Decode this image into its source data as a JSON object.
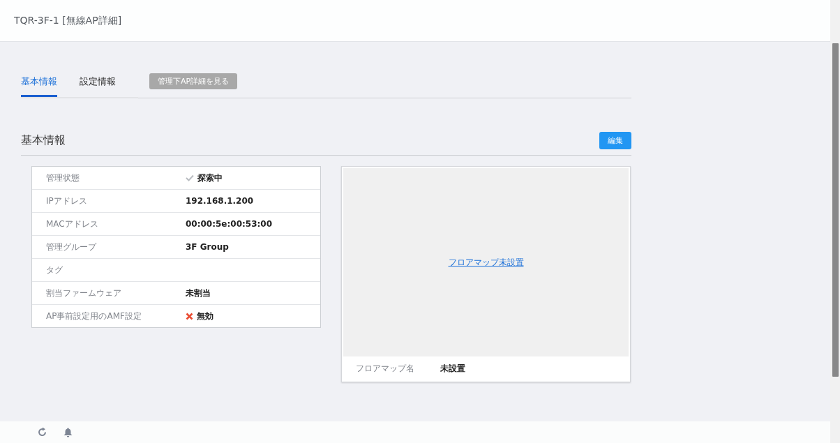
{
  "window": {
    "title": "TQR-3F-1 [無線AP詳細]"
  },
  "tabs": [
    {
      "label": "基本情報",
      "selected": true
    },
    {
      "label": "設定情報",
      "selected": false
    }
  ],
  "view_button": {
    "label": "管理下AP詳細を見る",
    "disabled": true
  },
  "section": {
    "title": "基本情報",
    "edit_button": "編集"
  },
  "details": [
    {
      "kind": "check",
      "label": "管理状態",
      "value": "探索中"
    },
    {
      "kind": "plain",
      "label": "IPアドレス",
      "value": "192.168.1.200"
    },
    {
      "kind": "plain",
      "label": "MACアドレス",
      "value": "00:00:5e:00:53:00"
    },
    {
      "kind": "plain",
      "label": "管理グループ",
      "value": "3F Group"
    },
    {
      "kind": "plain",
      "label": "タグ"
    },
    {
      "kind": "plain",
      "label": "割当ファームウェア",
      "value": "未割当"
    },
    {
      "kind": "cross",
      "label": "AP事前設定用のAMF設定",
      "value": "無効"
    }
  ],
  "floor_map": {
    "link": "フロアマップ未設置",
    "name_label": "フロアマップ名",
    "name_value": "未設置"
  }
}
